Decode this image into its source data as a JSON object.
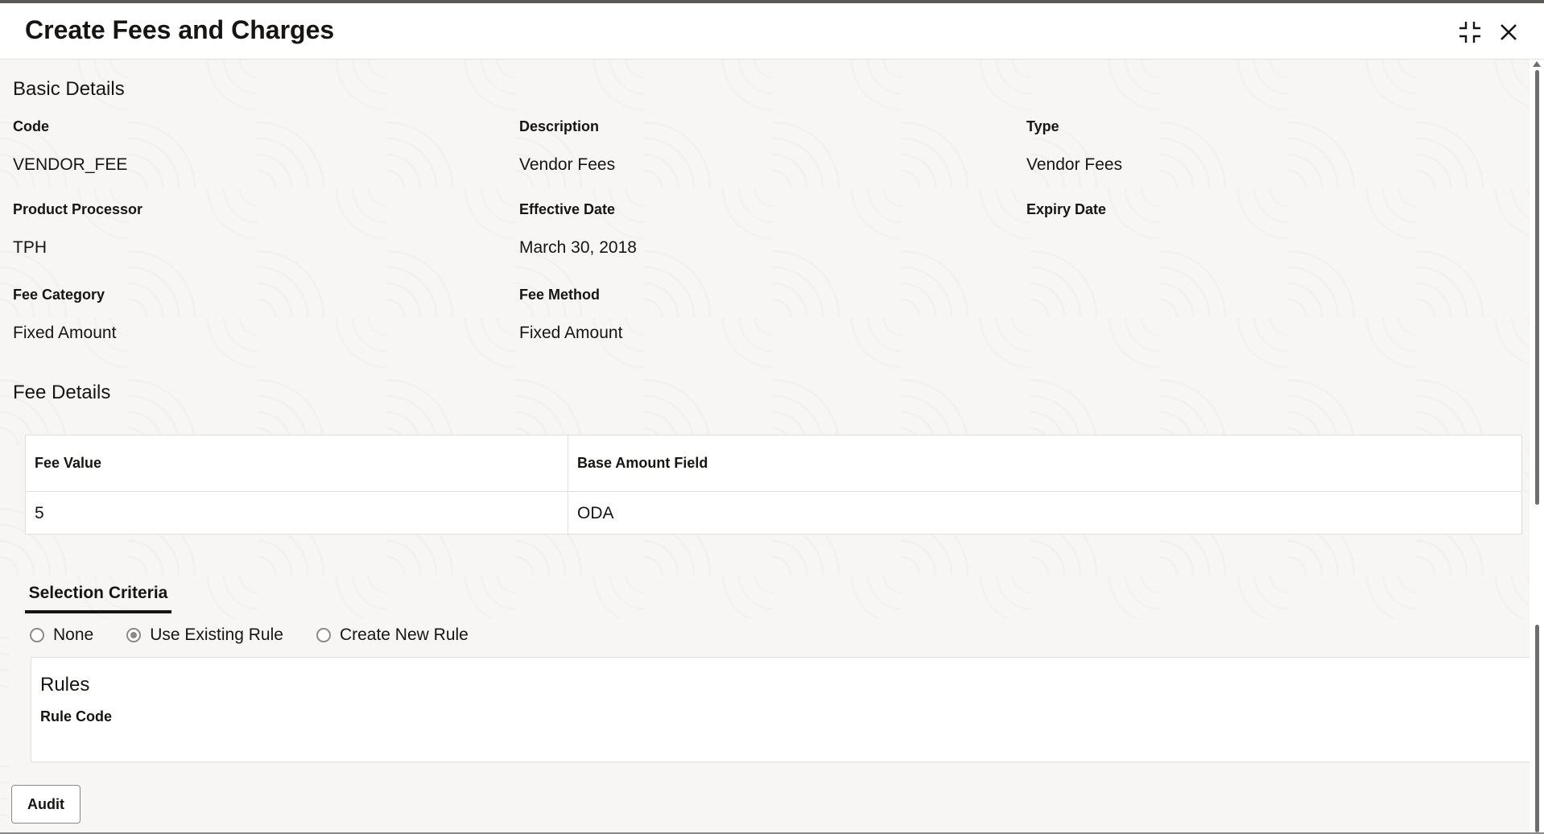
{
  "dialog": {
    "title": "Create Fees and Charges"
  },
  "header_icons": {
    "minimize": "collapse-icon",
    "close": "close-icon"
  },
  "basic_details": {
    "section_title": "Basic Details",
    "code_label": "Code",
    "code_value": "VENDOR_FEE",
    "description_label": "Description",
    "description_value": "Vendor Fees",
    "type_label": "Type",
    "type_value": "Vendor Fees",
    "product_processor_label": "Product Processor",
    "product_processor_value": "TPH",
    "effective_date_label": "Effective Date",
    "effective_date_value": "March 30, 2018",
    "expiry_date_label": "Expiry Date",
    "expiry_date_value": "",
    "fee_category_label": "Fee Category",
    "fee_category_value": "Fixed Amount",
    "fee_method_label": "Fee Method",
    "fee_method_value": "Fixed Amount"
  },
  "fee_details": {
    "section_title": "Fee Details",
    "columns": [
      "Fee Value",
      "Base Amount Field"
    ],
    "rows": [
      [
        "5",
        "ODA"
      ]
    ]
  },
  "selection_criteria": {
    "tab_label": "Selection Criteria",
    "options": [
      {
        "label": "None",
        "checked": false
      },
      {
        "label": "Use Existing Rule",
        "checked": true
      },
      {
        "label": "Create New Rule",
        "checked": false
      }
    ],
    "rules_title": "Rules",
    "rule_code_label": "Rule Code"
  },
  "footer": {
    "audit_label": "Audit"
  },
  "colors": {
    "text": "#161513",
    "body_bg": "#f7f6f4",
    "border": "#e0deda"
  }
}
